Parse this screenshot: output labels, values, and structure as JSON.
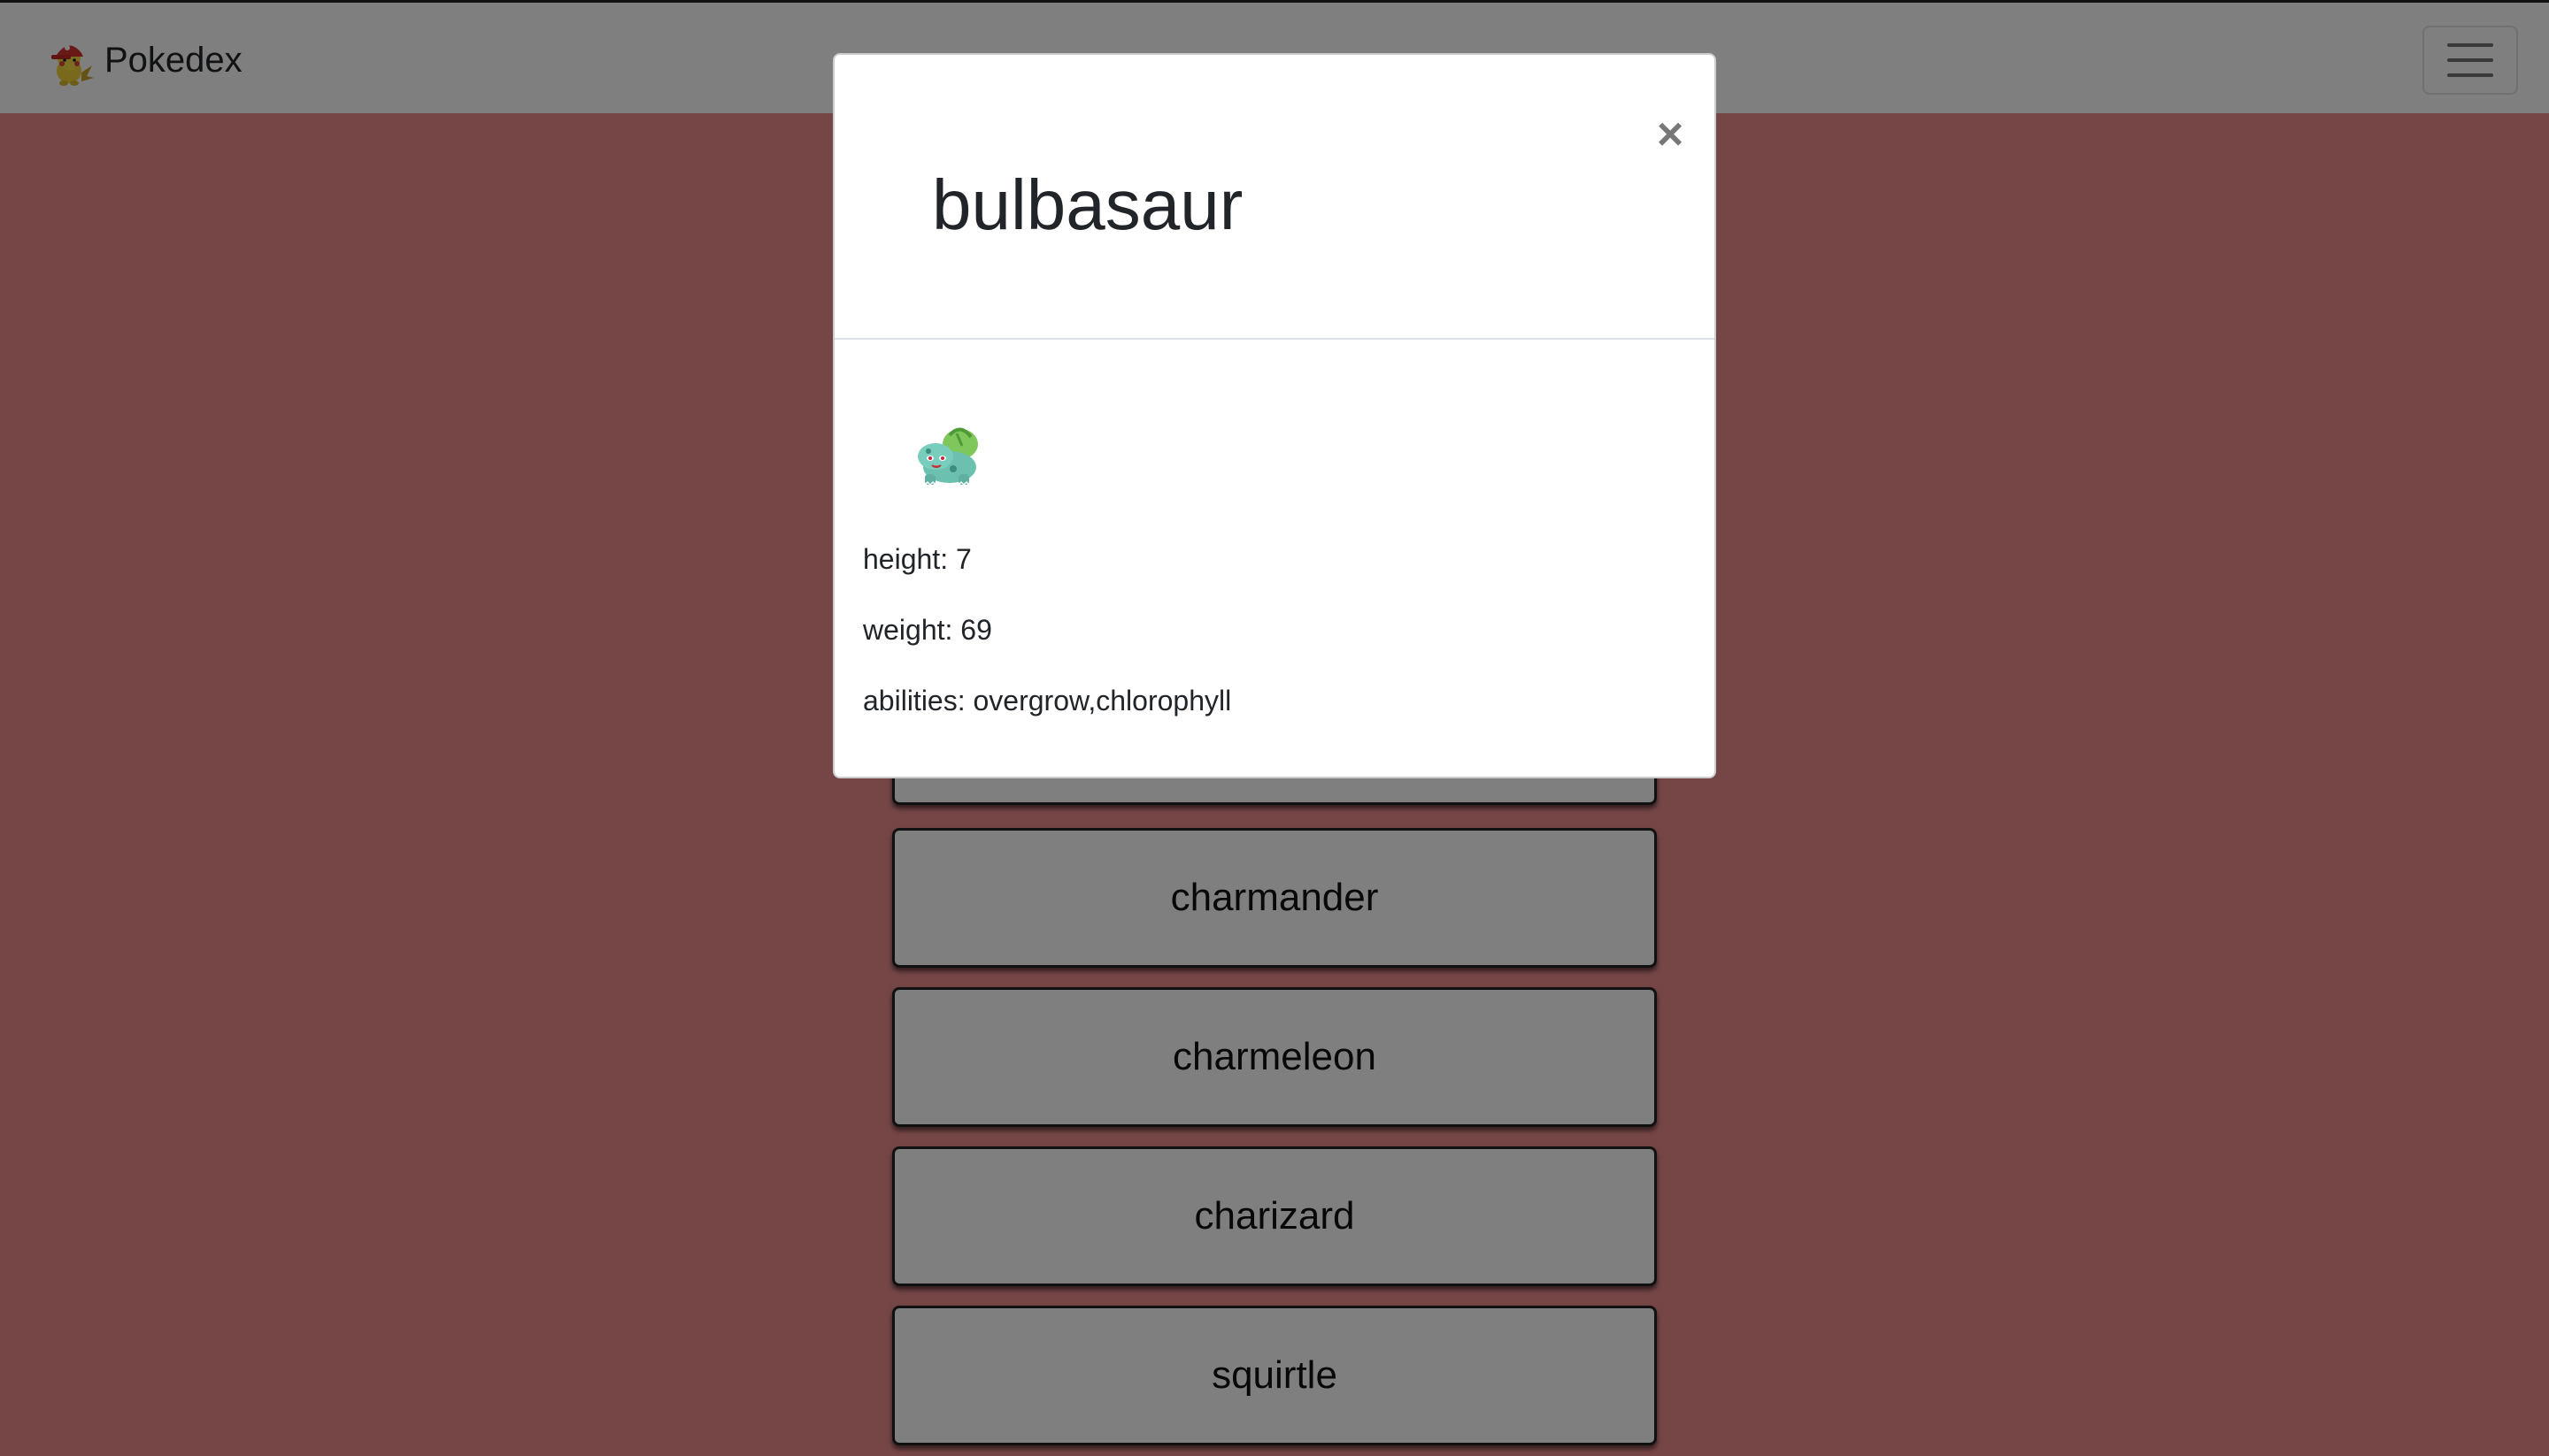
{
  "navbar": {
    "brand": "Pokedex",
    "logo_icon": "pikachu-ash-hat-icon",
    "toggler_icon": "hamburger-menu-icon"
  },
  "pokemon_list": [
    {
      "name": "charmander"
    },
    {
      "name": "charmeleon"
    },
    {
      "name": "charizard"
    },
    {
      "name": "squirtle"
    }
  ],
  "modal": {
    "title": "bulbasaur",
    "close_label": "×",
    "sprite_icon": "bulbasaur-sprite",
    "height_text": "height: 7",
    "weight_text": "weight: 69",
    "abilities_text": "abilities: overgrow,chlorophyll"
  },
  "colors": {
    "page_background": "#ec8c8e",
    "navbar_background": "#ffffff",
    "button_background": "#ffffff",
    "backdrop": "rgba(0,0,0,0.5)"
  }
}
